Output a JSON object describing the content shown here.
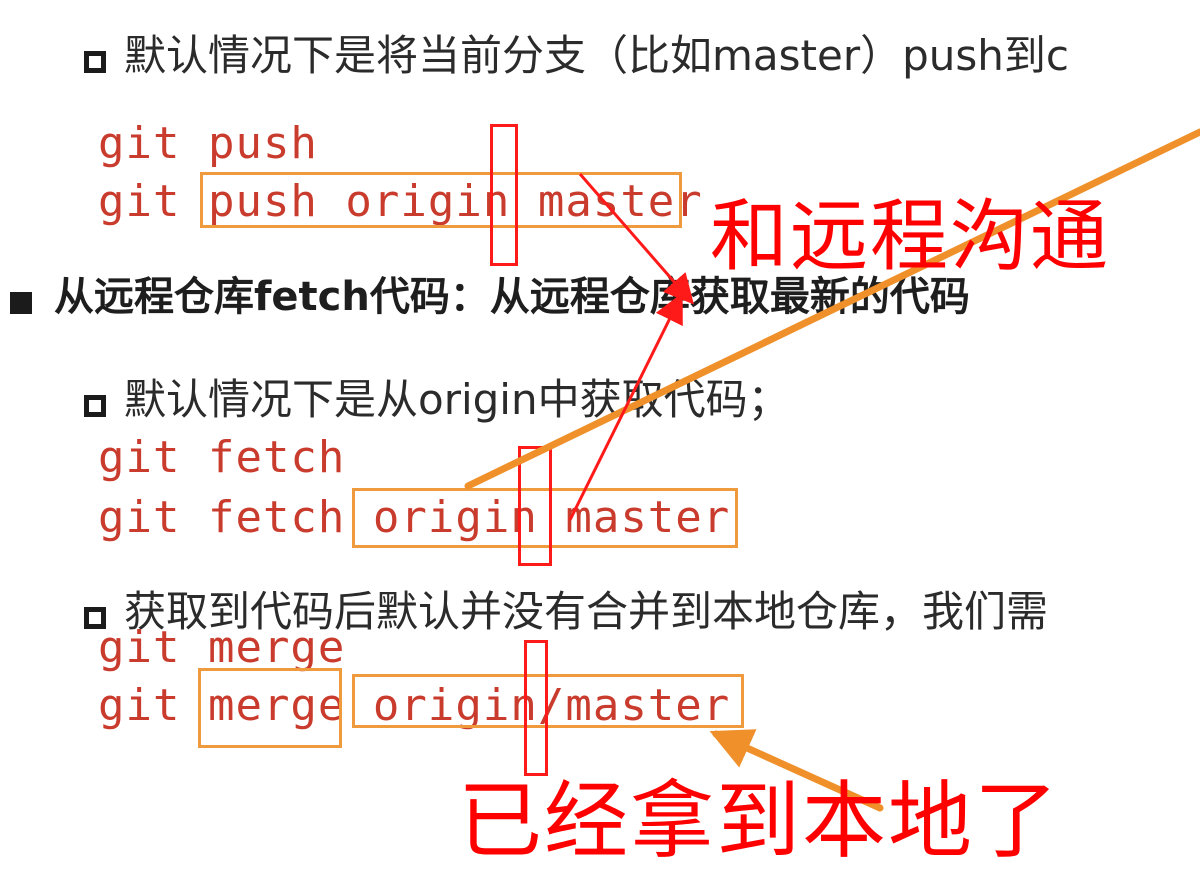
{
  "slide": {
    "bullet_push_default": "默认情况下是将当前分支（比如master）push到c",
    "cmd_git_push": "git push",
    "cmd_git_push_origin_master": "git push origin master",
    "heading_fetch": "从远程仓库fetch代码：从远程仓库获取最新的代码",
    "bullet_fetch_default": "默认情况下是从origin中获取代码；",
    "cmd_git_fetch": "git fetch",
    "cmd_git_fetch_origin_master": "git fetch origin master",
    "bullet_fetch_merge": "获取到代码后默认并没有合并到本地仓库，我们需",
    "cmd_git_merge": "git merge",
    "cmd_git_merge_origin_master": "git merge origin/master"
  },
  "annotations": {
    "remote_note": "和远程沟通",
    "local_note": "已经拿到本地了"
  },
  "colors": {
    "code_red": "#c93b2c",
    "box_orange": "#ef9a3c",
    "arrow_orange": "#f0902a",
    "annotation_red": "#ff0000",
    "text_dark": "#2b2b2b"
  }
}
